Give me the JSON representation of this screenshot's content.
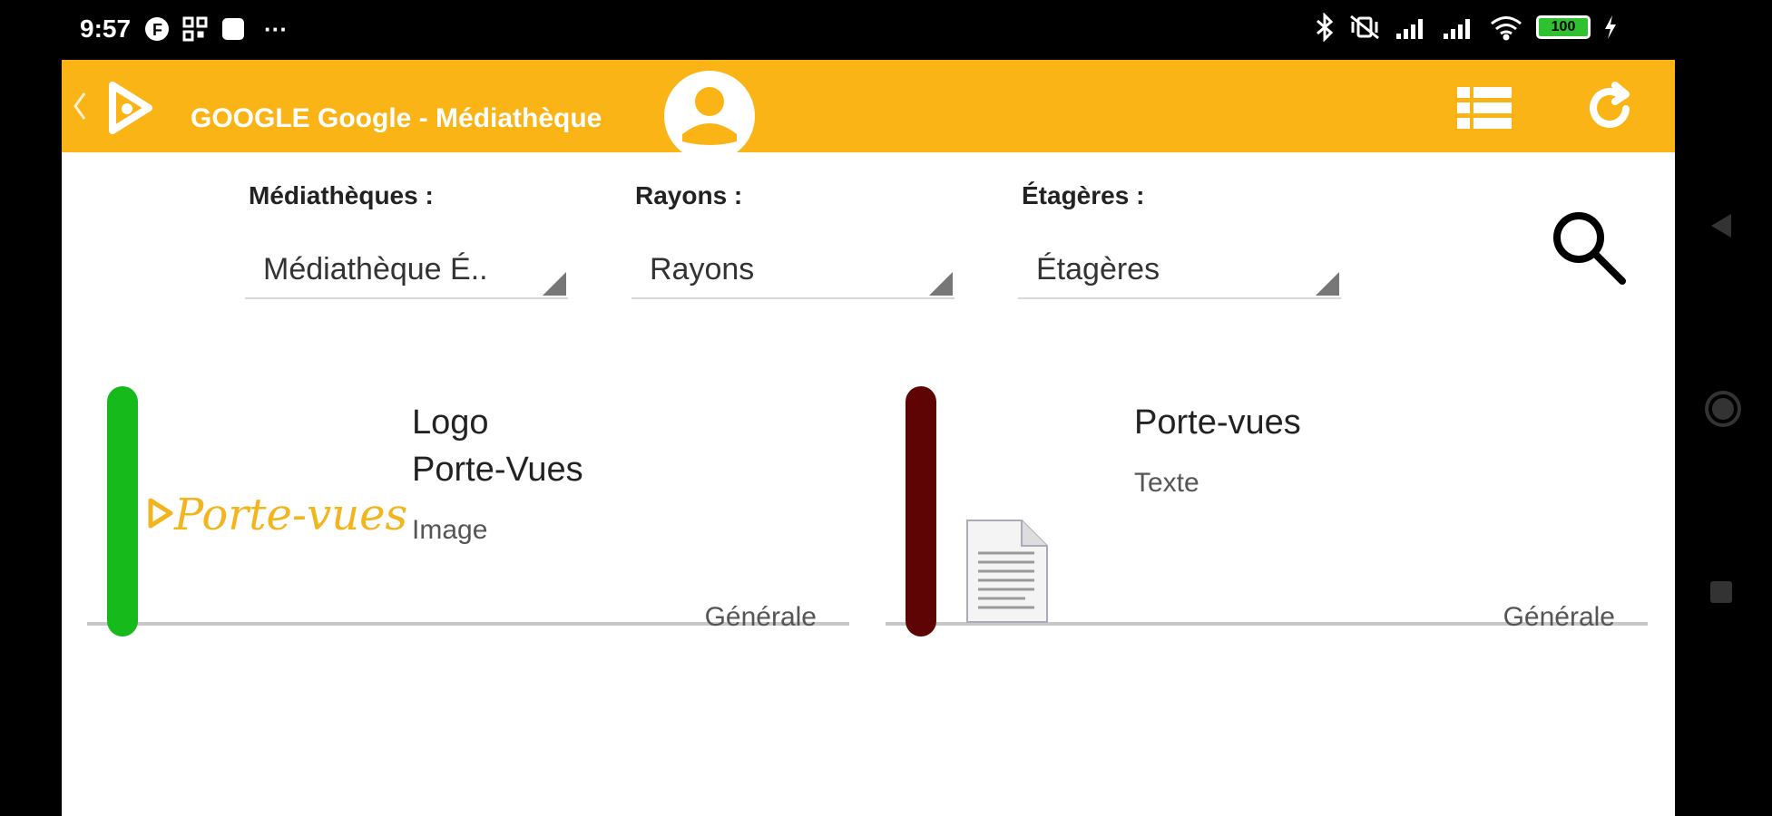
{
  "status_bar": {
    "time": "9:57",
    "overflow": "···",
    "battery_level": "100",
    "left_icons": [
      "notification-f-icon",
      "qr-icon",
      "app-square-icon"
    ],
    "right_icons": [
      "bluetooth-icon",
      "mute-vibrate-icon",
      "signal-icon",
      "signal-icon",
      "wifi-icon",
      "battery-icon",
      "charging-icon"
    ]
  },
  "app_bar": {
    "title": "GOOGLE Google - Médiathèque",
    "icons": [
      "back-chevron-icon",
      "app-logo-icon",
      "user-avatar-icon",
      "list-view-icon",
      "refresh-icon"
    ],
    "color": "#FBB415"
  },
  "filters": {
    "mediatheques": {
      "label": "Médiathèques :",
      "value": "Médiathèque É.."
    },
    "rayons": {
      "label": "Rayons :",
      "value": "Rayons"
    },
    "etageres": {
      "label": "Étagères :",
      "value": "Étagères"
    },
    "search_icon": "search-icon"
  },
  "items": [
    {
      "title_line1": "Logo",
      "title_line2": "Porte-Vues",
      "type": "Image",
      "shelf": "Générale",
      "color": "#16BA1A",
      "thumb_text": "Porte-vues"
    },
    {
      "title": "Porte-vues",
      "type": "Texte",
      "shelf": "Générale",
      "color": "#5E0404",
      "thumb_icon": "document-icon"
    }
  ],
  "nav_bar": {
    "icons": [
      "back-triangle-icon",
      "home-circle-icon",
      "recents-square-icon"
    ]
  }
}
